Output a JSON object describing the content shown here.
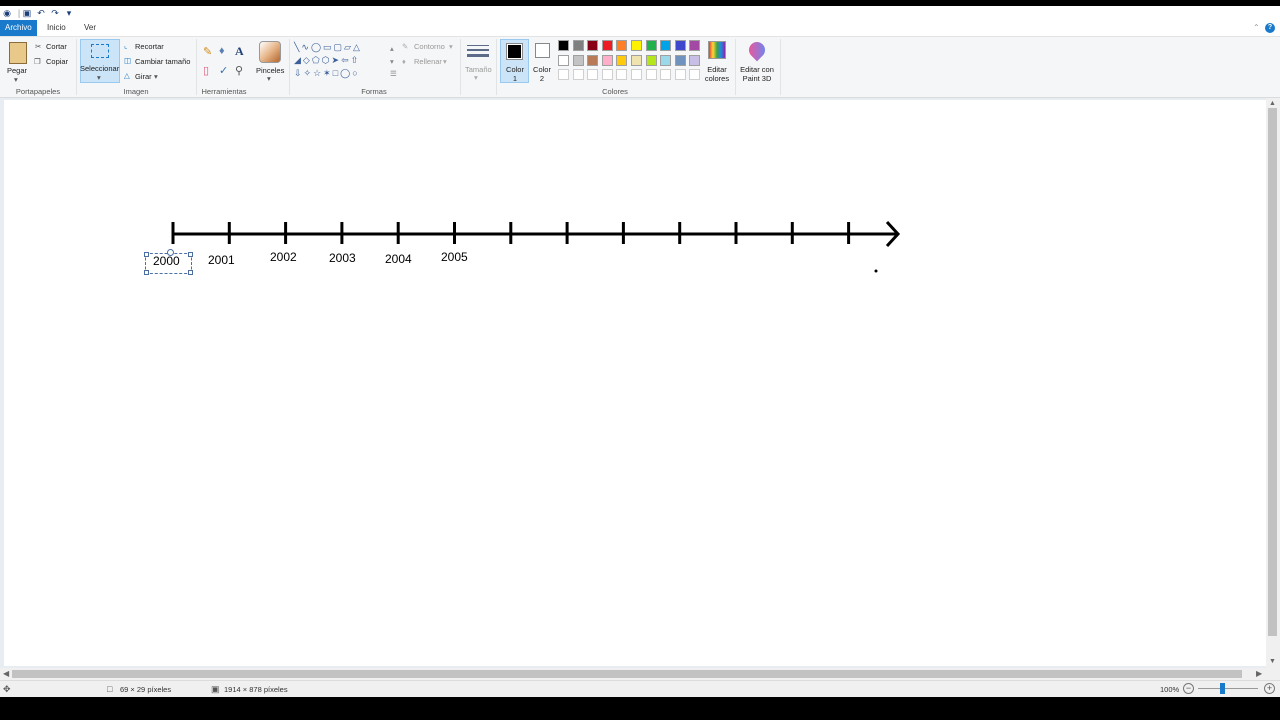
{
  "quick_access": {
    "icons": [
      "paint-app-icon",
      "save-icon",
      "undo-icon",
      "redo-icon",
      "customize-icon"
    ]
  },
  "tabs": [
    {
      "label": "Archivo"
    },
    {
      "label": "Inicio"
    },
    {
      "label": "Ver"
    }
  ],
  "ribbon": {
    "clipboard": {
      "paste": "Pegar",
      "cut": "Cortar",
      "copy": "Copiar",
      "group": "Portapapeles"
    },
    "image": {
      "select": "Seleccionar",
      "crop": "Recortar",
      "resize": "Cambiar tamaño",
      "rotate": "Girar",
      "group": "Imagen"
    },
    "tools": {
      "group": "Herramientas"
    },
    "brushes": {
      "label": "Pinceles"
    },
    "shapes": {
      "outline": "Contorno",
      "fill": "Rellenar",
      "group": "Formas"
    },
    "size": {
      "label": "Tamaño"
    },
    "colors": {
      "color1": "Color 1",
      "color2": "Color 2",
      "edit_colors": "Editar colores",
      "group": "Colores",
      "color1_value": "#000000",
      "color2_value": "#ffffff",
      "palette": [
        [
          "#000000",
          "#7f7f7f",
          "#880015",
          "#ed1c24",
          "#ff7f27",
          "#fff200",
          "#22b14c",
          "#00a2e8",
          "#3f48cc",
          "#a349a4"
        ],
        [
          "#ffffff",
          "#c3c3c3",
          "#b97a57",
          "#ffaec9",
          "#ffc90e",
          "#efe4b0",
          "#b5e61d",
          "#99d9ea",
          "#7092be",
          "#c8bfe7"
        ],
        [
          "#ffffff",
          "#ffffff",
          "#ffffff",
          "#ffffff",
          "#ffffff",
          "#ffffff",
          "#ffffff",
          "#ffffff",
          "#ffffff",
          "#ffffff"
        ]
      ]
    },
    "paint3d": {
      "label": "Editar con Paint 3D"
    }
  },
  "canvas": {
    "years": [
      "2000",
      "2001",
      "2002",
      "2003",
      "2004",
      "2005"
    ]
  },
  "status": {
    "selection_size": "69 × 29 píxeles",
    "image_size": "1914 × 878 píxeles",
    "zoom": "100%",
    "zoom_fraction": 0.4
  }
}
